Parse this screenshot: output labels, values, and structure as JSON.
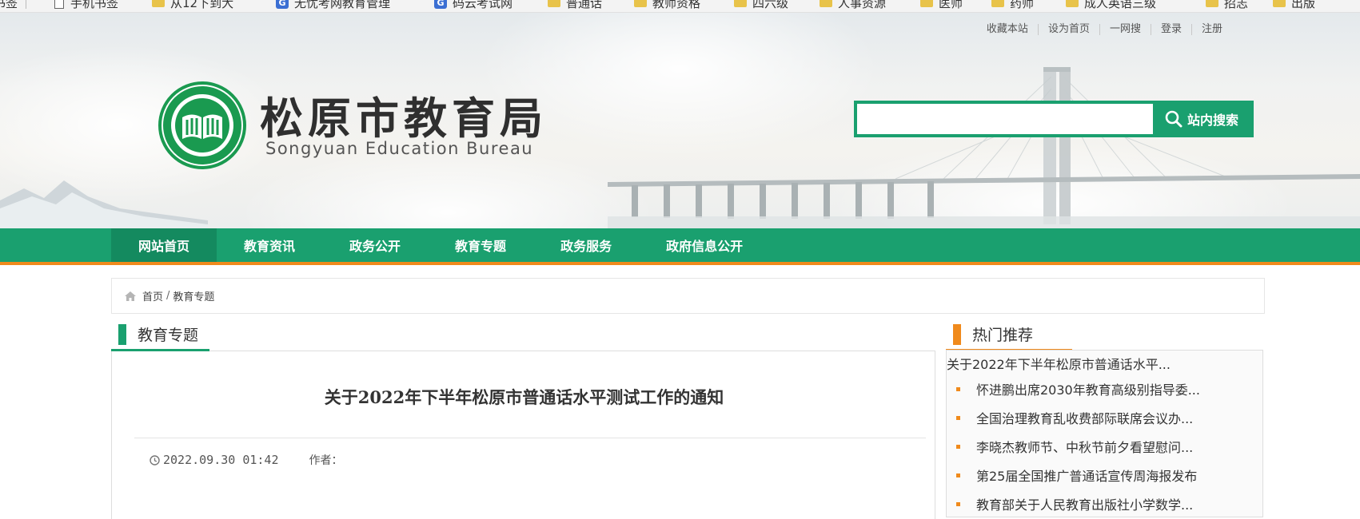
{
  "bookmarks": [
    {
      "label": "书签",
      "icon": "none"
    },
    {
      "label": "手机书签",
      "icon": "page-icon"
    },
    {
      "label": "从12下到大",
      "icon": "folder-icon"
    },
    {
      "label": "无忧考网教育管理",
      "icon": "g-site-icon"
    },
    {
      "label": "码云考试网",
      "icon": "g-site-icon"
    },
    {
      "label": "普通话",
      "icon": "folder-icon"
    },
    {
      "label": "教师资格",
      "icon": "folder-icon"
    },
    {
      "label": "四六级",
      "icon": "folder-icon"
    },
    {
      "label": "人事资源",
      "icon": "folder-icon"
    },
    {
      "label": "医师",
      "icon": "folder-icon"
    },
    {
      "label": "药师",
      "icon": "folder-icon"
    },
    {
      "label": "成人英语三级",
      "icon": "folder-icon"
    },
    {
      "label": "招志",
      "icon": "folder-icon"
    },
    {
      "label": "出版",
      "icon": "folder-icon"
    }
  ],
  "header": {
    "toplinks": [
      "收藏本站",
      "设为首页",
      "一网搜",
      "登录",
      "注册"
    ],
    "title": "松原市教育局",
    "subtitle": "Songyuan Education Bureau",
    "search": {
      "placeholder": "",
      "button_label": "站内搜索"
    }
  },
  "nav": {
    "items": [
      "网站首页",
      "教育资讯",
      "政务公开",
      "教育专题",
      "政务服务",
      "政府信息公开"
    ],
    "active_index": 0
  },
  "breadcrumb": {
    "home": "首页",
    "separator": "/",
    "current": "教育专题"
  },
  "main": {
    "section_title": "教育专题",
    "article": {
      "title": "关于2022年下半年松原市普通话水平测试工作的通知",
      "date": "2022.09.30 01:42",
      "author_label": "作者："
    }
  },
  "sidebar": {
    "title": "热门推荐",
    "first_item": "关于2022年下半年松原市普通话水平...",
    "items": [
      "怀进鹏出席2030年教育高级别指导委...",
      "全国治理教育乱收费部际联席会议办...",
      "李晓杰教师节、中秋节前夕看望慰问...",
      "第25届全国推广普通话宣传周海报发布",
      "教育部关于人民教育出版社小学数学..."
    ]
  },
  "colors": {
    "brand_green": "#1aa06f",
    "accent_orange": "#f08a1c",
    "nav_active": "#148a5f"
  }
}
